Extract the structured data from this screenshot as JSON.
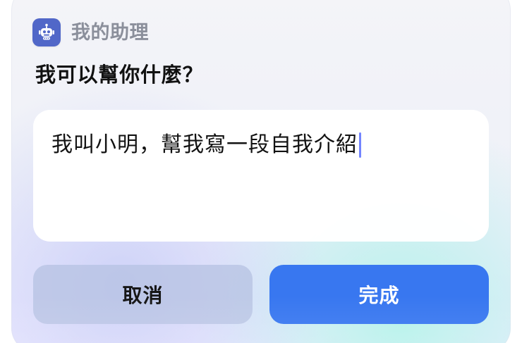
{
  "app": {
    "name": "我的助理",
    "icon": "robot-icon",
    "colors": {
      "icon_background": "#5167C8",
      "primary_button": "#3877F0",
      "secondary_button": "#B6C1E2",
      "cursor": "#7385FF"
    }
  },
  "dialog": {
    "title": "我可以幫你什麼？",
    "input": {
      "value": "我叫小明，幫我寫一段自我介紹"
    }
  },
  "actions": {
    "cancel": "取消",
    "done": "完成"
  }
}
